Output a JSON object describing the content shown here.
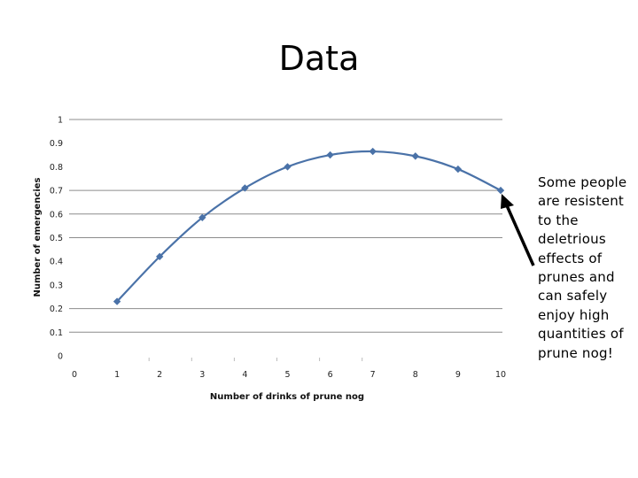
{
  "slide": {
    "title": "Data",
    "annotation": "Some people are resistent to the deletrious effects of prunes and can safely enjoy high quantities of prune nog!",
    "annotation_arrow": "arrow-pointing-to-last-data-point"
  },
  "colors": {
    "series": "#4a72a8",
    "gridline": "#8c8c8c",
    "arrow": "#000000"
  },
  "chart_data": {
    "type": "line",
    "title": "",
    "xlabel": "Number of drinks of prune nog",
    "ylabel": "Number of emergencies",
    "x": [
      1,
      2,
      3,
      4,
      5,
      6,
      7,
      8,
      9,
      10
    ],
    "series": [
      {
        "name": "Number of emergencies",
        "values": [
          0.23,
          0.42,
          0.585,
          0.71,
          0.8,
          0.85,
          0.865,
          0.845,
          0.79,
          0.7
        ],
        "marker": "diamond",
        "smooth": true
      }
    ],
    "xlim": [
      0,
      10
    ],
    "ylim": [
      0,
      1
    ],
    "xticks": [
      "0",
      "1",
      "2",
      "3",
      "4",
      "5",
      "6",
      "7",
      "8",
      "9",
      "10"
    ],
    "yticks": [
      "0",
      "0.1",
      "0.2",
      "0.3",
      "0.4",
      "0.5",
      "0.6",
      "0.7",
      "0.8",
      "0.9",
      "1"
    ],
    "grid": true,
    "visible_gridlines": [
      0.1,
      0.2,
      0.5,
      0.6,
      0.7,
      1
    ],
    "legend": "none"
  }
}
